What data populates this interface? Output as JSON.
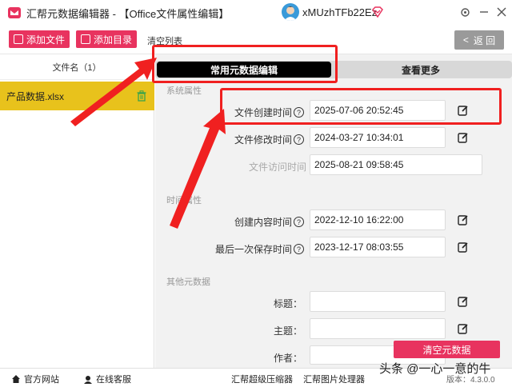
{
  "window": {
    "title": "汇帮元数据编辑器 - 【Office文件属性编辑】",
    "user_name": "xMUzhTFb22Ez"
  },
  "toolbar": {
    "add_file": "添加文件",
    "add_folder": "添加目录",
    "clear_list": "清空列表",
    "back": "返 回"
  },
  "file_list": {
    "header": "文件名（1）",
    "items": [
      {
        "name": "产品数据.xlsx"
      }
    ]
  },
  "tabs": {
    "active": "常用元数据编辑",
    "inactive": "查看更多"
  },
  "sections": {
    "system": "系统属性",
    "time": "时间属性",
    "other": "其他元数据"
  },
  "fields": {
    "created": {
      "label": "文件创建时间",
      "value": "2025-07-06 20:52:45"
    },
    "modified": {
      "label": "文件修改时间",
      "value": "2024-03-27 10:34:01"
    },
    "accessed": {
      "label": "文件访问时间",
      "value": "2025-08-21 09:58:45"
    },
    "content_created": {
      "label": "创建内容时间",
      "value": "2022-12-10 16:22:00"
    },
    "last_saved": {
      "label": "最后一次保存时间",
      "value": "2023-12-17 08:03:55"
    },
    "title": {
      "label": "标题：",
      "value": ""
    },
    "subject": {
      "label": "主题：",
      "value": ""
    },
    "author": {
      "label": "作者：",
      "value": ""
    }
  },
  "clear_meta": "清空元数据",
  "bottom": {
    "website": "官方网站",
    "support": "在线客服",
    "compressor": "汇帮超级压缩器",
    "image_tool": "汇帮图片处理器",
    "version": "版本：4.3.0.0"
  },
  "watermark": "头条 @一心一意的牛",
  "colors": {
    "accent": "#e8335f",
    "selected": "#e8c21c",
    "highlight": "#f02020"
  }
}
